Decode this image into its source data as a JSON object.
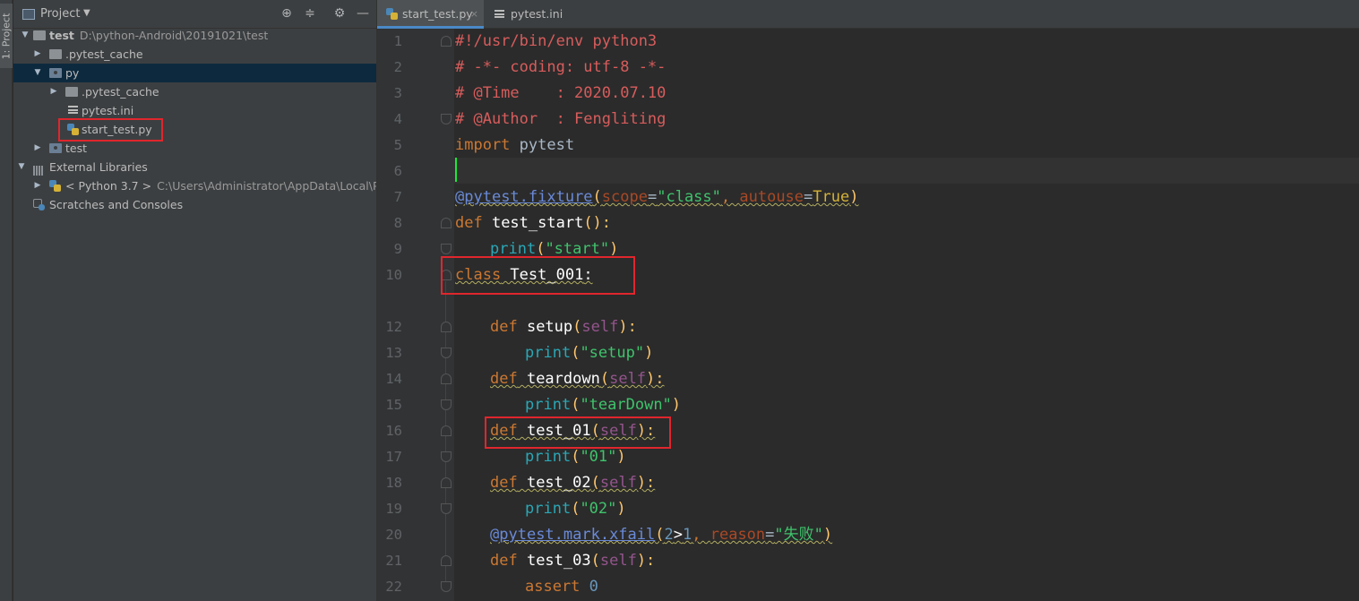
{
  "toolstrip": {
    "project_tab": "1: Project"
  },
  "project_panel": {
    "title": "Project",
    "tree": [
      {
        "label": "test",
        "path": "D:\\python-Android\\20191021\\test"
      },
      {
        "label": ".pytest_cache"
      },
      {
        "label": "py"
      },
      {
        "label": ".pytest_cache"
      },
      {
        "label": "pytest.ini"
      },
      {
        "label": "start_test.py"
      },
      {
        "label": "test"
      },
      {
        "label": "External Libraries"
      },
      {
        "label": "< Python 3.7 >",
        "path": "C:\\Users\\Administrator\\AppData\\Local\\Prog"
      },
      {
        "label": "Scratches and Consoles"
      }
    ]
  },
  "tabs": [
    {
      "label": "start_test.py",
      "close": "×"
    },
    {
      "label": "pytest.ini"
    }
  ],
  "line_numbers": [
    "1",
    "2",
    "3",
    "4",
    "5",
    "6",
    "7",
    "8",
    "9",
    "10",
    "",
    "12",
    "13",
    "14",
    "15",
    "16",
    "17",
    "18",
    "19",
    "20",
    "21",
    "22"
  ],
  "code": {
    "l1": "#!/usr/bin/env python3",
    "l2": "# -*- coding: utf-8 -*-",
    "l3": "# @Time    : 2020.07.10",
    "l4": "# @Author  : Fengliting",
    "l5_kw": "import",
    "l5_mod": " pytest",
    "l7_at": "@",
    "l7_a": "pytest.fixture",
    "l7_b": "(",
    "l7_c": "scope",
    "l7_d": "=",
    "l7_e": "\"class\"",
    "l7_f": ", ",
    "l7_g": "autouse",
    "l7_h": "=",
    "l7_i": "True",
    "l7_j": ")",
    "l8_kw": "def",
    "l8_fn": " test_start",
    "l8_rest": "():",
    "l9_b": "print",
    "l9_p1": "(",
    "l9_s": "\"start\"",
    "l9_p2": ")",
    "l10_kw": "class",
    "l10_name": " Test_001",
    "l10_rest": ":",
    "l12_kw": "def",
    "l12_fn": " setup",
    "l12_p1": "(",
    "l12_self": "self",
    "l12_p2": "):",
    "l13_b": "print",
    "l13_p1": "(",
    "l13_s": "\"setup\"",
    "l13_p2": ")",
    "l14_kw": "def",
    "l14_fn": " teardown",
    "l14_p1": "(",
    "l14_self": "self",
    "l14_p2": "):",
    "l15_b": "print",
    "l15_p1": "(",
    "l15_s": "\"tearDown\"",
    "l15_p2": ")",
    "l16_kw": "def",
    "l16_fn": " test_01",
    "l16_p1": "(",
    "l16_self": "self",
    "l16_p2": "):",
    "l17_b": "print",
    "l17_p1": "(",
    "l17_s": "\"01\"",
    "l17_p2": ")",
    "l18_kw": "def",
    "l18_fn": " test_02",
    "l18_p1": "(",
    "l18_self": "self",
    "l18_p2": "):",
    "l19_b": "print",
    "l19_p1": "(",
    "l19_s": "\"02\"",
    "l19_p2": ")",
    "l20_at": "@",
    "l20_a": "pytest.mark.xfail",
    "l20_b": "(",
    "l20_n1": "2",
    "l20_op": ">",
    "l20_n2": "1",
    "l20_c": ", ",
    "l20_param": "reason",
    "l20_eq": "=",
    "l20_s": "\"失败\"",
    "l20_e": ")",
    "l21_kw": "def",
    "l21_fn": " test_03",
    "l21_p1": "(",
    "l21_self": "self",
    "l21_p2": "):",
    "l22_kw": "assert",
    "l22_n": " 0"
  }
}
